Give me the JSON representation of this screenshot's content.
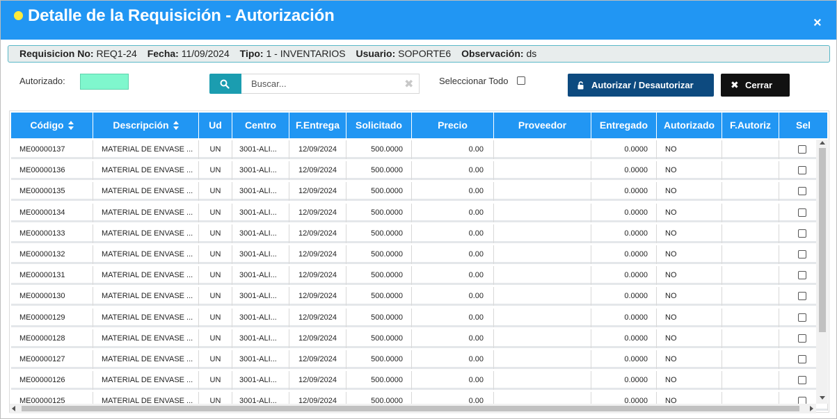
{
  "modal": {
    "title": "Detalle de la Requisición - Autorización",
    "close": "×"
  },
  "info": {
    "req_label": "Requisicion No:",
    "req_value": "REQ1-24",
    "fecha_label": "Fecha:",
    "fecha_value": "11/09/2024",
    "tipo_label": "Tipo:",
    "tipo_value": "1 - INVENTARIOS",
    "usuario_label": "Usuario:",
    "usuario_value": "SOPORTE6",
    "obs_label": "Observación:",
    "obs_value": "ds"
  },
  "toolbar": {
    "autorizado_label": "Autorizado:",
    "autorizado_color": "#7ff7cd",
    "search_placeholder": "Buscar...",
    "search_value": "",
    "select_all_label": "Seleccionar Todo",
    "select_all_checked": false,
    "authorize_button": "Autorizar / Desautorizar",
    "close_button": "Cerrar"
  },
  "table": {
    "columns": [
      "Código",
      "Descripción",
      "Ud",
      "Centro",
      "F.Entrega",
      "Solicitado",
      "Precio",
      "Proveedor",
      "Entregado",
      "Autorizado",
      "F.Autoriz",
      "Sel"
    ],
    "rows": [
      {
        "codigo": "ME00000137",
        "descripcion": "MATERIAL DE ENVASE ...",
        "ud": "UN",
        "centro": "3001-ALI...",
        "fentrega": "12/09/2024",
        "solicitado": "500.0000",
        "precio": "0.00",
        "proveedor": "",
        "entregado": "0.0000",
        "autorizado": "NO",
        "fautoriz": "",
        "sel": false
      },
      {
        "codigo": "ME00000136",
        "descripcion": "MATERIAL DE ENVASE ...",
        "ud": "UN",
        "centro": "3001-ALI...",
        "fentrega": "12/09/2024",
        "solicitado": "500.0000",
        "precio": "0.00",
        "proveedor": "",
        "entregado": "0.0000",
        "autorizado": "NO",
        "fautoriz": "",
        "sel": false
      },
      {
        "codigo": "ME00000135",
        "descripcion": "MATERIAL DE ENVASE ...",
        "ud": "UN",
        "centro": "3001-ALI...",
        "fentrega": "12/09/2024",
        "solicitado": "500.0000",
        "precio": "0.00",
        "proveedor": "",
        "entregado": "0.0000",
        "autorizado": "NO",
        "fautoriz": "",
        "sel": false
      },
      {
        "codigo": "ME00000134",
        "descripcion": "MATERIAL DE ENVASE ...",
        "ud": "UN",
        "centro": "3001-ALI...",
        "fentrega": "12/09/2024",
        "solicitado": "500.0000",
        "precio": "0.00",
        "proveedor": "",
        "entregado": "0.0000",
        "autorizado": "NO",
        "fautoriz": "",
        "sel": false
      },
      {
        "codigo": "ME00000133",
        "descripcion": "MATERIAL DE ENVASE ...",
        "ud": "UN",
        "centro": "3001-ALI...",
        "fentrega": "12/09/2024",
        "solicitado": "500.0000",
        "precio": "0.00",
        "proveedor": "",
        "entregado": "0.0000",
        "autorizado": "NO",
        "fautoriz": "",
        "sel": false
      },
      {
        "codigo": "ME00000132",
        "descripcion": "MATERIAL DE ENVASE ...",
        "ud": "UN",
        "centro": "3001-ALI...",
        "fentrega": "12/09/2024",
        "solicitado": "500.0000",
        "precio": "0.00",
        "proveedor": "",
        "entregado": "0.0000",
        "autorizado": "NO",
        "fautoriz": "",
        "sel": false
      },
      {
        "codigo": "ME00000131",
        "descripcion": "MATERIAL DE ENVASE ...",
        "ud": "UN",
        "centro": "3001-ALI...",
        "fentrega": "12/09/2024",
        "solicitado": "500.0000",
        "precio": "0.00",
        "proveedor": "",
        "entregado": "0.0000",
        "autorizado": "NO",
        "fautoriz": "",
        "sel": false
      },
      {
        "codigo": "ME00000130",
        "descripcion": "MATERIAL DE ENVASE ...",
        "ud": "UN",
        "centro": "3001-ALI...",
        "fentrega": "12/09/2024",
        "solicitado": "500.0000",
        "precio": "0.00",
        "proveedor": "",
        "entregado": "0.0000",
        "autorizado": "NO",
        "fautoriz": "",
        "sel": false
      },
      {
        "codigo": "ME00000129",
        "descripcion": "MATERIAL DE ENVASE ...",
        "ud": "UN",
        "centro": "3001-ALI...",
        "fentrega": "12/09/2024",
        "solicitado": "500.0000",
        "precio": "0.00",
        "proveedor": "",
        "entregado": "0.0000",
        "autorizado": "NO",
        "fautoriz": "",
        "sel": false
      },
      {
        "codigo": "ME00000128",
        "descripcion": "MATERIAL DE ENVASE ...",
        "ud": "UN",
        "centro": "3001-ALI...",
        "fentrega": "12/09/2024",
        "solicitado": "500.0000",
        "precio": "0.00",
        "proveedor": "",
        "entregado": "0.0000",
        "autorizado": "NO",
        "fautoriz": "",
        "sel": false
      },
      {
        "codigo": "ME00000127",
        "descripcion": "MATERIAL DE ENVASE ...",
        "ud": "UN",
        "centro": "3001-ALI...",
        "fentrega": "12/09/2024",
        "solicitado": "500.0000",
        "precio": "0.00",
        "proveedor": "",
        "entregado": "0.0000",
        "autorizado": "NO",
        "fautoriz": "",
        "sel": false
      },
      {
        "codigo": "ME00000126",
        "descripcion": "MATERIAL DE ENVASE ...",
        "ud": "UN",
        "centro": "3001-ALI...",
        "fentrega": "12/09/2024",
        "solicitado": "500.0000",
        "precio": "0.00",
        "proveedor": "",
        "entregado": "0.0000",
        "autorizado": "NO",
        "fautoriz": "",
        "sel": false
      },
      {
        "codigo": "ME00000125",
        "descripcion": "MATERIAL DE ENVASE ...",
        "ud": "UN",
        "centro": "3001-ALI...",
        "fentrega": "12/09/2024",
        "solicitado": "500.0000",
        "precio": "0.00",
        "proveedor": "",
        "entregado": "0.0000",
        "autorizado": "NO",
        "fautoriz": "",
        "sel": false
      }
    ]
  }
}
